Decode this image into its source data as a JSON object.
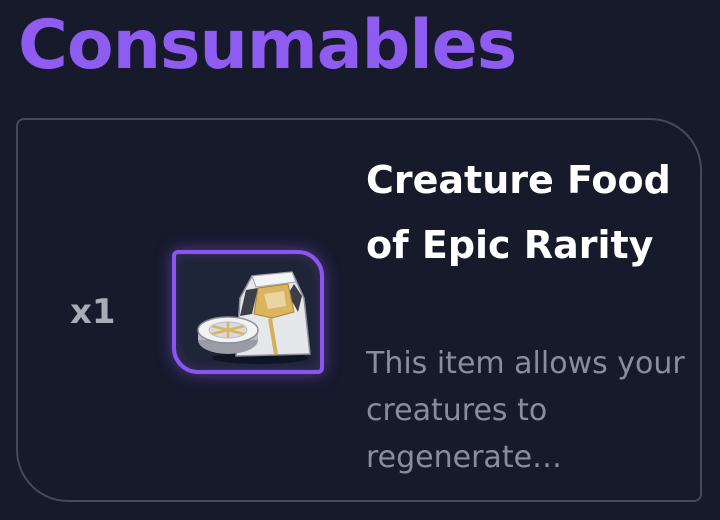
{
  "section": {
    "title": "Consumables"
  },
  "item": {
    "quantity": "x1",
    "name": "Creature Food of Epic Rarity",
    "description": "This item allows your creatures to regenerate Movement Points.",
    "icon": "creature-food-bag-icon",
    "rarity": "Epic"
  },
  "colors": {
    "background": "#161a2b",
    "title": "#8f5cf2",
    "epic_frame": "#8a56ef",
    "card_border": "#444a5a",
    "name_text": "#ffffff",
    "description_text": "#8a8e9b",
    "quantity_text": "#a9acb6"
  }
}
